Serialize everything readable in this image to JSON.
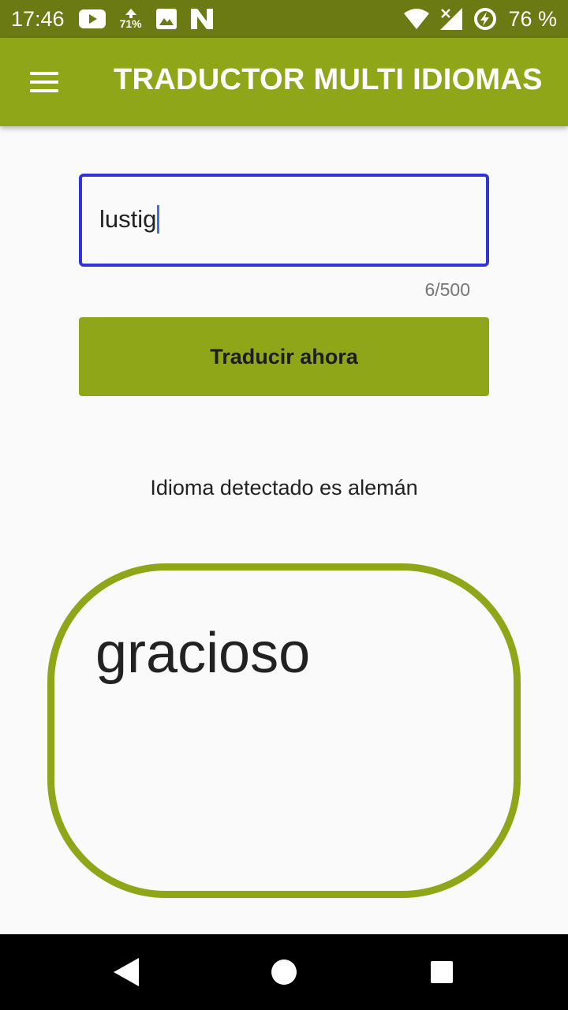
{
  "status_bar": {
    "time": "17:46",
    "left_icons": [
      "youtube-icon",
      "data-usage-icon",
      "image-icon",
      "n-icon"
    ],
    "data_pct": "71%",
    "right_icons": [
      "wifi-icon",
      "cell-signal-icon",
      "battery-charging-icon"
    ],
    "battery": "76 %"
  },
  "app_bar": {
    "title": "TRADUCTOR MULTI IDIOMAS",
    "menu_icon": "hamburger-menu-icon",
    "color": "#90a619"
  },
  "input": {
    "value": "lustig",
    "counter": "6/500",
    "border_color": "#3333dd"
  },
  "translate_button": {
    "label": "Traducir ahora"
  },
  "detected_language": "Idioma detectado es alemán",
  "result": {
    "text": "gracioso"
  },
  "nav_bar": {
    "icons": [
      "back-icon",
      "home-icon",
      "recents-icon"
    ]
  }
}
